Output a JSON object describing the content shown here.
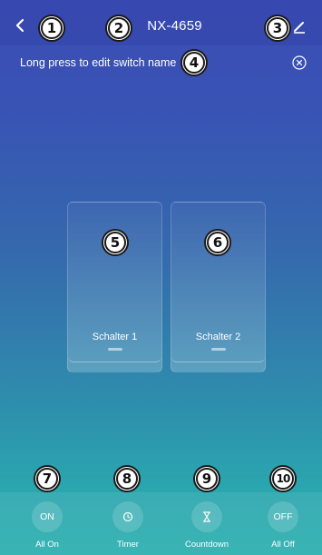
{
  "header": {
    "title": "NX-4659",
    "back_icon": "chevron-left-icon",
    "edit_icon": "pencil-icon"
  },
  "hint": {
    "text": "Long press to edit switch name",
    "close_icon": "close-circle-icon"
  },
  "switches": [
    {
      "label": "Schalter 1"
    },
    {
      "label": "Schalter 2"
    }
  ],
  "actions": [
    {
      "icon_text": "ON",
      "label": "All On"
    },
    {
      "icon": "clock-icon",
      "label": "Timer"
    },
    {
      "icon": "hourglass-icon",
      "label": "Countdown"
    },
    {
      "icon_text": "OFF",
      "label": "All Off"
    }
  ],
  "markers": [
    "1",
    "2",
    "3",
    "4",
    "5",
    "6",
    "7",
    "8",
    "9",
    "10"
  ],
  "colors": {
    "gradient_top": "#3d4fb8",
    "gradient_bottom": "#29aeae"
  }
}
